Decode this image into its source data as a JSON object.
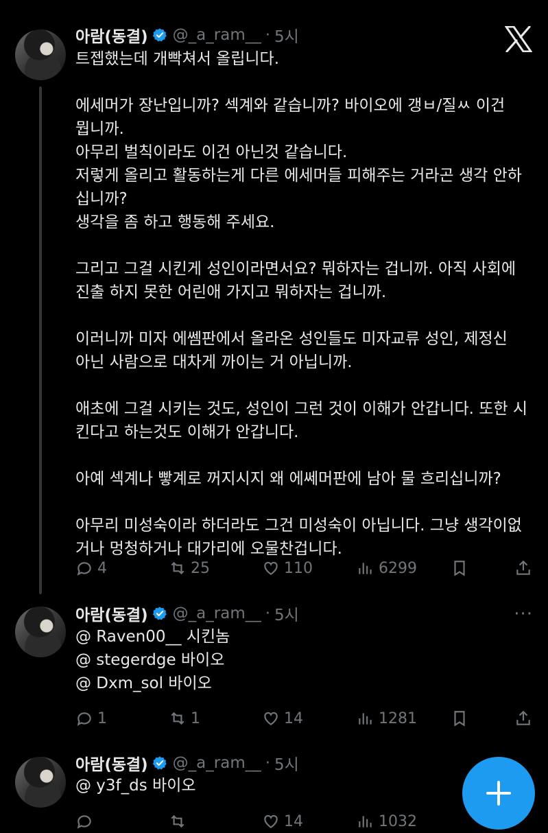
{
  "brand_logo": "x-logo",
  "fab": {
    "icon": "plus-icon",
    "color": "#1d9bf0"
  },
  "tweets": [
    {
      "author": {
        "name": "아람(동결)",
        "handle": "@_a_ram__",
        "verified": true
      },
      "separator": "·",
      "time": "5시",
      "lines": [
        "트젭했는데 개빡쳐서 올립니다.",
        "",
        "에세머가 장난입니까? 섹계와 같습니까? 바이오에 갱ㅂ/질ㅆ 이건",
        "뭡니까.",
        "아무리 벌칙이라도 이건 아닌것 같습니다.",
        "저렇게 올리고 활동하는게 다른 에세머들 피해주는 거라곤 생각 안하",
        "십니까?",
        "생각을 좀 하고 행동해 주세요.",
        "",
        "그리고 그걸 시킨게 성인이라면서요? 뭐하자는 겁니까. 아직 사회에",
        "진출 하지 못한 어린애 가지고 뭐하자는 겁니까.",
        "",
        "이러니까 미자 에쎔판에서 올라온 성인들도 미자교류 성인, 제정신",
        "아닌 사람으로 대차게 까이는 거 아닙니까.",
        "",
        "애초에 그걸 시키는 것도, 성인이 그런 것이 이해가 안갑니다. 또한 시",
        "킨다고 하는것도 이해가 안갑니다.",
        "",
        "아예 섹계나 빻계로 꺼지시지 왜 에쎄머판에 남아 물 흐리십니까?",
        "",
        "아무리 미성숙이라 하더라도 그건 미성숙이 아닙니다. 그냥 생각이없",
        "거나 멍청하거나 대가리에 오물찬겁니다."
      ],
      "stats": {
        "replies": "4",
        "reposts": "25",
        "likes": "110",
        "views": "6299"
      }
    },
    {
      "author": {
        "name": "아람(동결)",
        "handle": "@_a_ram__",
        "verified": true
      },
      "separator": "·",
      "time": "5시",
      "lines": [
        "@ Raven00__  시킨놈",
        "@ stegerdge 바이오",
        "@ Dxm_sol 바이오"
      ],
      "stats": {
        "replies": "1",
        "reposts": "1",
        "likes": "14",
        "views": "1281"
      }
    },
    {
      "author": {
        "name": "아람(동결)",
        "handle": "@_a_ram__",
        "verified": true
      },
      "separator": "·",
      "time": "5시",
      "lines": [
        "@ y3f_ds 바이오"
      ],
      "stats": {
        "replies": "",
        "reposts": "",
        "likes": "14",
        "views": "1032"
      }
    }
  ]
}
